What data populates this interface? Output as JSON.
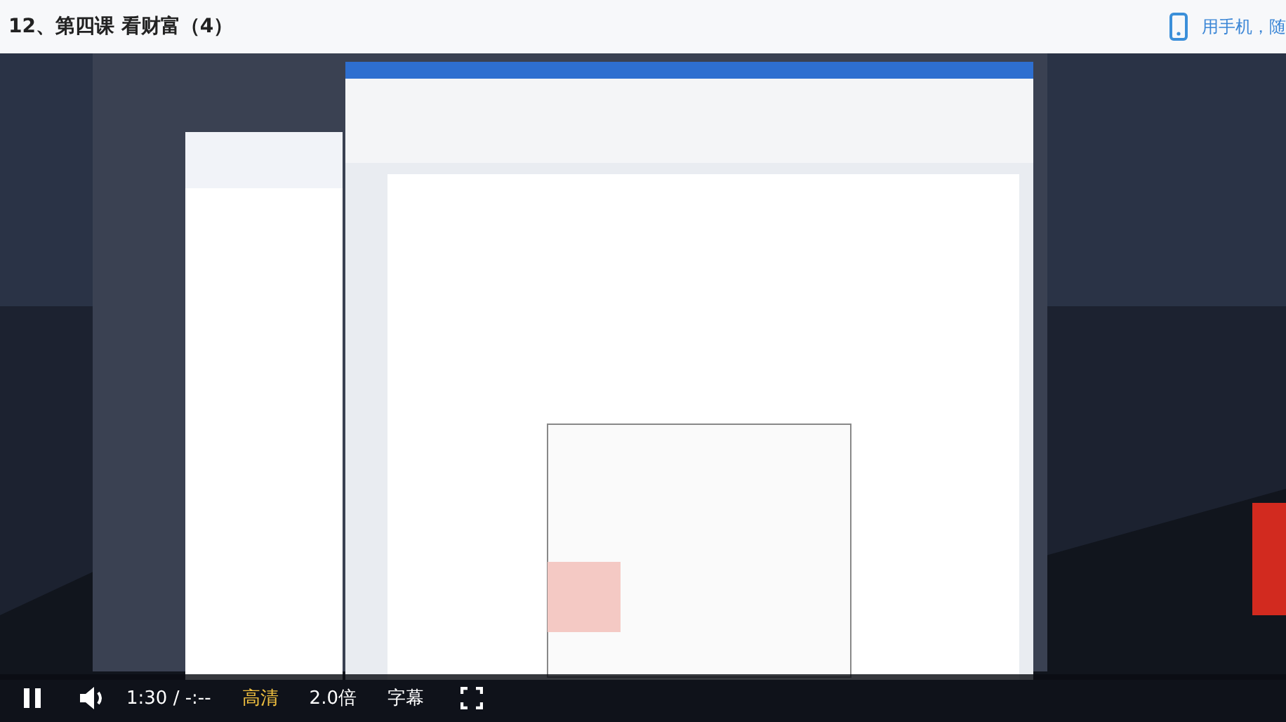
{
  "header": {
    "title": "12、第四课 看财富（4）",
    "mobile_link": "用手机，随"
  },
  "controls": {
    "playing": true,
    "time": "1:30 / -:--",
    "options": [
      {
        "label": "高清",
        "selected": true
      },
      {
        "label": "2.0倍",
        "selected": false
      },
      {
        "label": "字幕",
        "selected": false
      }
    ]
  }
}
